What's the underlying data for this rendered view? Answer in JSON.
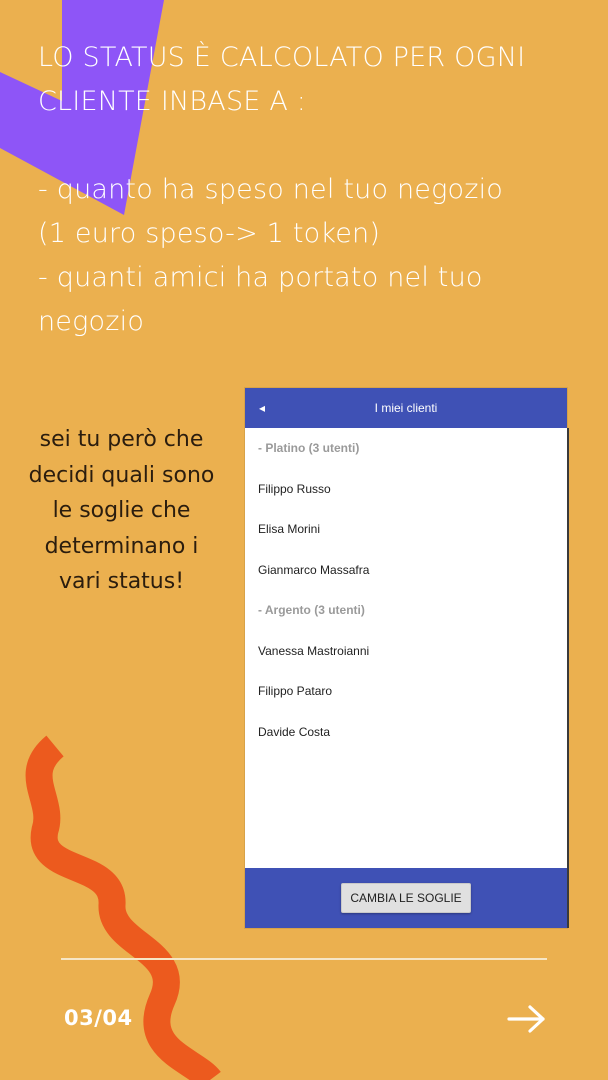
{
  "colors": {
    "background": "#EBB04F",
    "purple_shape": "#8E55F7",
    "orange_squiggle": "#EC5A1E",
    "app_bar": "#3F51B5"
  },
  "headline": {
    "line1": "LO STATUS È CALCOLATO PER OGNI",
    "line2": "CLIENTE INBASE A :",
    "line3": "- quanto ha speso nel tuo negozio",
    "line4": "(1 euro speso-> 1 token)",
    "line5": "- quanti amici ha portato nel tuo",
    "line6": "negozio"
  },
  "side_text": {
    "line1": "sei tu però che",
    "line2": "decidi quali sono",
    "line3": "le soglie che",
    "line4": "determinano i",
    "line5": "vari status!"
  },
  "phone": {
    "back_icon": "◂",
    "title": "I miei clienti",
    "groups": [
      {
        "header": "- Platino (3 utenti)",
        "clients": [
          "Filippo Russo",
          "Elisa Morini",
          "Gianmarco Massafra"
        ]
      },
      {
        "header": "- Argento (3 utenti)",
        "clients": [
          "Vanessa Mastroianni",
          "Filippo Pataro",
          "Davide Costa"
        ]
      }
    ],
    "button_label": "CAMBIA LE SOGLIE"
  },
  "footer": {
    "page_counter": "03/04",
    "next_icon": "arrow-right-icon"
  }
}
